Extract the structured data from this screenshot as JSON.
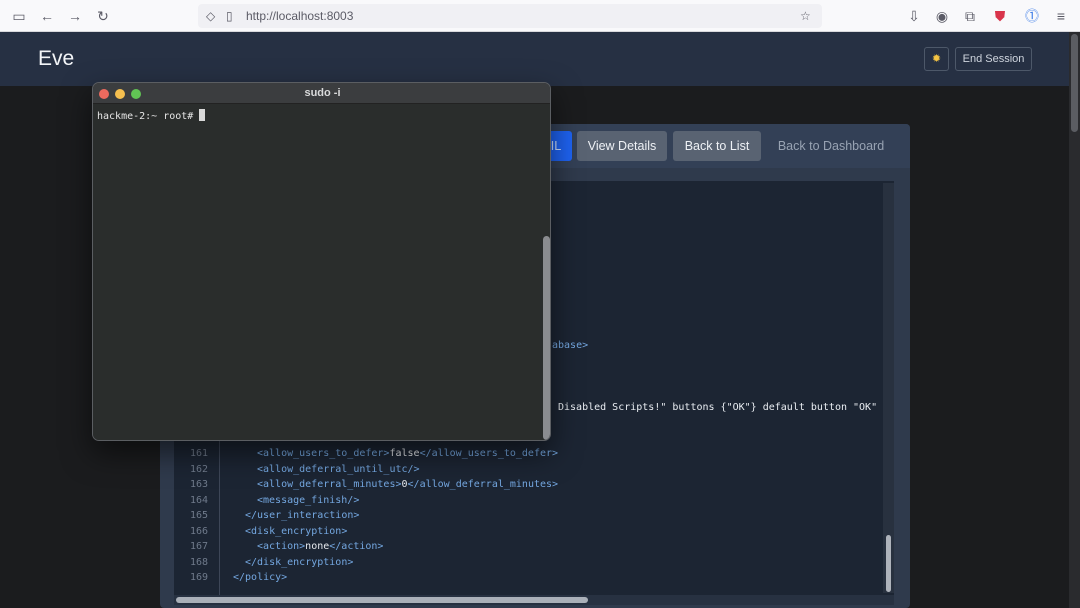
{
  "browser": {
    "url": "http://localhost:8003"
  },
  "app": {
    "brand": "Eve",
    "theme_icon": "sun-icon",
    "end_session_label": "End Session"
  },
  "toolbar": {
    "primary_partial_label": "IL",
    "view_details_label": "View Details",
    "back_to_list_label": "Back to List",
    "back_to_dashboard_label": "Back to Dashboard"
  },
  "code_fragments": {
    "partial_database": "abase>",
    "partial_script": "Disabled Scripts!\" buttons {\"OK\"} default button \"OK\""
  },
  "code_lines": [
    {
      "n": "161",
      "indent": 4,
      "html": "<span class='tag'>&lt;allow_users_to_defer&gt;</span>false<span class='tag'>&lt;/allow_users_to_defer&gt;</span>"
    },
    {
      "n": "162",
      "indent": 4,
      "html": "<span class='tag'>&lt;allow_deferral_until_utc/&gt;</span>"
    },
    {
      "n": "163",
      "indent": 4,
      "html": "<span class='tag'>&lt;allow_deferral_minutes&gt;</span>0<span class='tag'>&lt;/allow_deferral_minutes&gt;</span>"
    },
    {
      "n": "164",
      "indent": 4,
      "html": "<span class='tag'>&lt;message_finish/&gt;</span>"
    },
    {
      "n": "165",
      "indent": 2,
      "html": "<span class='tag'>&lt;/user_interaction&gt;</span>"
    },
    {
      "n": "166",
      "indent": 2,
      "html": "<span class='tag'>&lt;disk_encryption&gt;</span>"
    },
    {
      "n": "167",
      "indent": 4,
      "html": "<span class='tag'>&lt;action&gt;</span>none<span class='tag'>&lt;/action&gt;</span>"
    },
    {
      "n": "168",
      "indent": 2,
      "html": "<span class='tag'>&lt;/disk_encryption&gt;</span>"
    },
    {
      "n": "169",
      "indent": 0,
      "html": "<span class='tag'>&lt;/policy&gt;</span>"
    }
  ],
  "terminal": {
    "title": "sudo -i",
    "prompt": "hackme-2:~ root#"
  }
}
